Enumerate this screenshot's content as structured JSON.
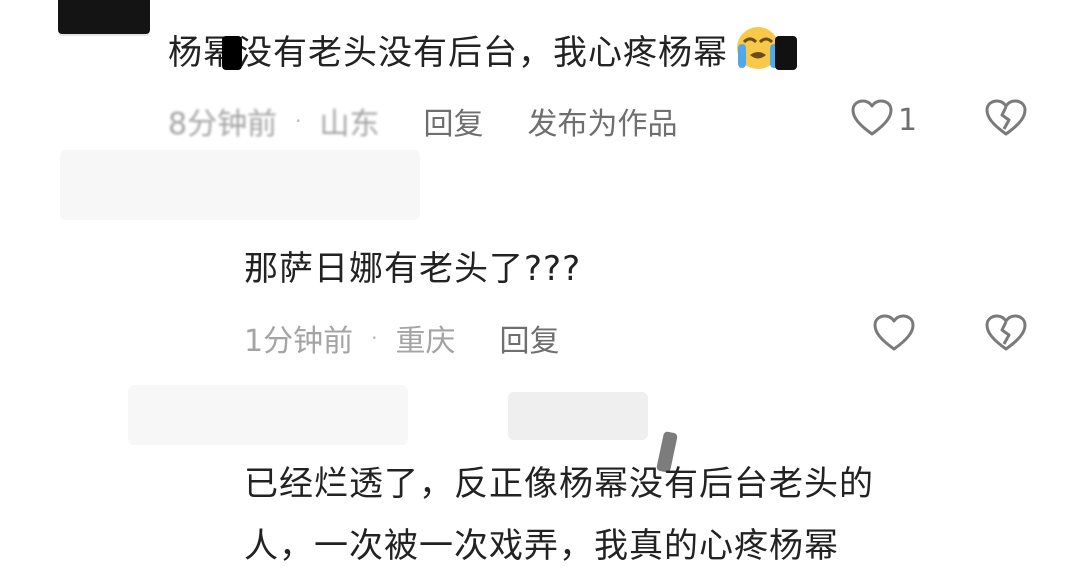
{
  "comments": [
    {
      "text": "杨幂没有老头没有后台，我心疼杨幂",
      "emoji": "loudly-crying-face",
      "time": "8分钟前",
      "location": "山东",
      "reply_label": "回复",
      "publish_label": "发布为作品",
      "likes": "1"
    },
    {
      "text": "那萨日娜有老头了???",
      "time": "1分钟前",
      "location": "重庆",
      "reply_label": "回复"
    },
    {
      "line1": "已经烂透了，反正像杨幂没有后台老头的",
      "line2": "人，一次被一次戏弄，我真的心疼杨幂"
    }
  ],
  "separator": "·",
  "colors": {
    "text": "#222222",
    "meta": "#a4a4a4",
    "action": "#6f6f6f",
    "icon": "#7a7a7a",
    "emoji_face": "#f7c94b",
    "emoji_tears": "#52a7e8"
  }
}
